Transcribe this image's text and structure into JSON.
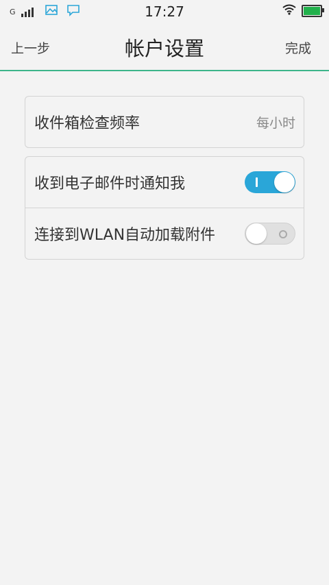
{
  "status_bar": {
    "network_type": "G",
    "time": "17:27",
    "icons": [
      "signal-icon",
      "gallery-notification-icon",
      "message-notification-icon",
      "wifi-icon",
      "battery-icon"
    ],
    "battery_level": 1.0,
    "accent_color": "#2aa6d8"
  },
  "header": {
    "back_label": "上一步",
    "title": "帐户设置",
    "done_label": "完成"
  },
  "settings": {
    "group1": {
      "check_frequency": {
        "label": "收件箱检查频率",
        "value": "每小时"
      }
    },
    "group2": {
      "notify_on_mail": {
        "label": "收到电子邮件时通知我",
        "enabled": true
      },
      "wlan_auto_download": {
        "label": "连接到WLAN自动加载附件",
        "enabled": false
      }
    }
  },
  "colors": {
    "header_divider": "#3cb48a",
    "toggle_on": "#2aa6d8",
    "battery": "#22b14c"
  }
}
